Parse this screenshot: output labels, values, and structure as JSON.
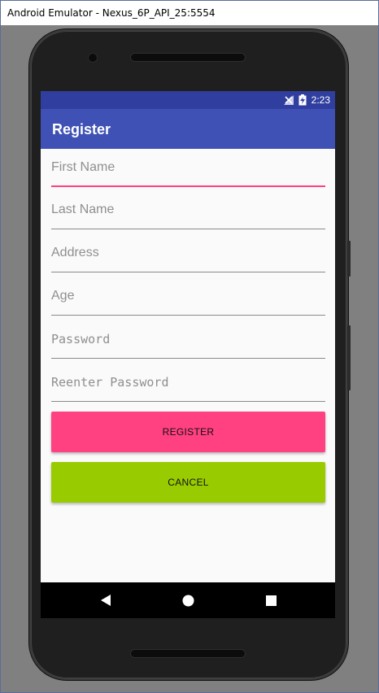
{
  "window": {
    "title": "Android Emulator - Nexus_6P_API_25:5554"
  },
  "status_bar": {
    "time": "2:23",
    "icons": [
      "signal-off-icon",
      "battery-charging-icon"
    ],
    "color": "#303f9f"
  },
  "app_bar": {
    "title": "Register",
    "color": "#3f51b5"
  },
  "form": {
    "first_name": {
      "placeholder": "First Name",
      "value": ""
    },
    "last_name": {
      "placeholder": "Last Name",
      "value": ""
    },
    "address": {
      "placeholder": "Address",
      "value": ""
    },
    "age": {
      "placeholder": "Age",
      "value": ""
    },
    "password": {
      "placeholder": "Password",
      "value": ""
    },
    "reenter_password": {
      "placeholder": "Reenter Password",
      "value": ""
    }
  },
  "buttons": {
    "register_label": "REGISTER",
    "cancel_label": "CANCEL",
    "register_color": "#ff4081",
    "cancel_color": "#99cc00"
  },
  "nav_bar": {
    "icons": [
      "back-icon",
      "home-icon",
      "recents-icon"
    ]
  },
  "colors": {
    "accent": "#ff4081"
  }
}
